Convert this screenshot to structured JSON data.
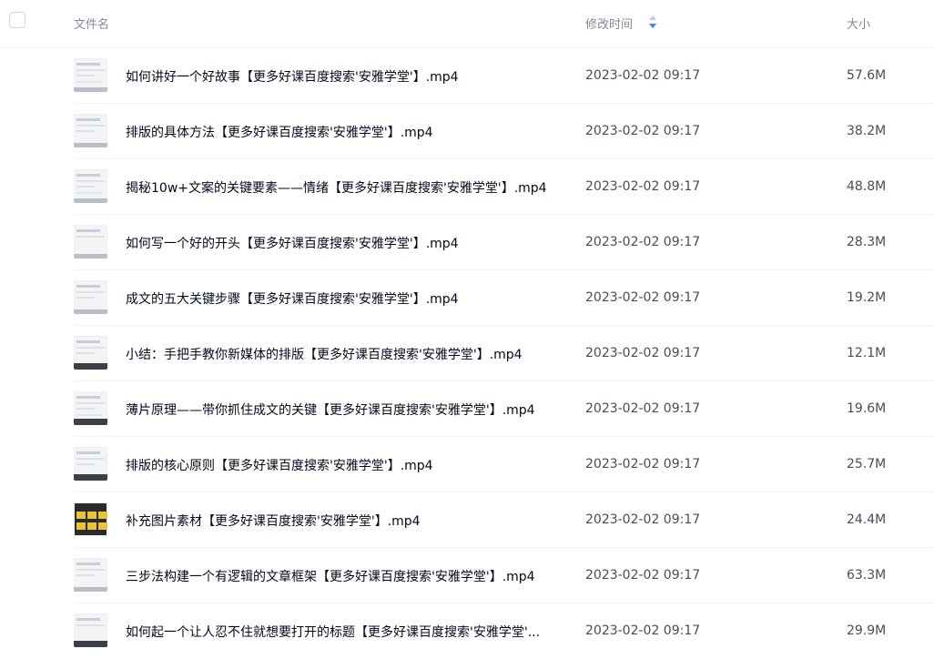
{
  "header": {
    "name_label": "文件名",
    "time_label": "修改时间",
    "size_label": "大小",
    "sort_icon": "sort-desc-icon",
    "sort_color": "#3b82f6"
  },
  "files": [
    {
      "name": "如何讲好一个好故事【更多好课百度搜索'安雅学堂'】.mp4",
      "time": "2023-02-02 09:17",
      "size": "57.6M"
    },
    {
      "name": "排版的具体方法【更多好课百度搜索'安雅学堂'】.mp4",
      "time": "2023-02-02 09:17",
      "size": "38.2M"
    },
    {
      "name": "揭秘10w+文案的关键要素——情绪【更多好课百度搜索'安雅学堂'】.mp4",
      "time": "2023-02-02 09:17",
      "size": "48.8M"
    },
    {
      "name": "如何写一个好的开头【更多好课百度搜索'安雅学堂'】.mp4",
      "time": "2023-02-02 09:17",
      "size": "28.3M"
    },
    {
      "name": "成文的五大关键步骤【更多好课百度搜索'安雅学堂'】.mp4",
      "time": "2023-02-02 09:17",
      "size": "19.2M"
    },
    {
      "name": "小结：手把手教你新媒体的排版【更多好课百度搜索'安雅学堂'】.mp4",
      "time": "2023-02-02 09:17",
      "size": "12.1M"
    },
    {
      "name": "薄片原理——带你抓住成文的关键【更多好课百度搜索'安雅学堂'】.mp4",
      "time": "2023-02-02 09:17",
      "size": "19.6M"
    },
    {
      "name": "排版的核心原则【更多好课百度搜索'安雅学堂'】.mp4",
      "time": "2023-02-02 09:17",
      "size": "25.7M"
    },
    {
      "name": "补充图片素材【更多好课百度搜索'安雅学堂'】.mp4",
      "time": "2023-02-02 09:17",
      "size": "24.4M"
    },
    {
      "name": "三步法构建一个有逻辑的文章框架【更多好课百度搜索'安雅学堂'】.mp4",
      "time": "2023-02-02 09:17",
      "size": "63.3M"
    },
    {
      "name": "如何起一个让人忍不住就想要打开的标题【更多好课百度搜索'安雅学堂'...",
      "time": "2023-02-02 09:17",
      "size": "29.9M"
    }
  ]
}
